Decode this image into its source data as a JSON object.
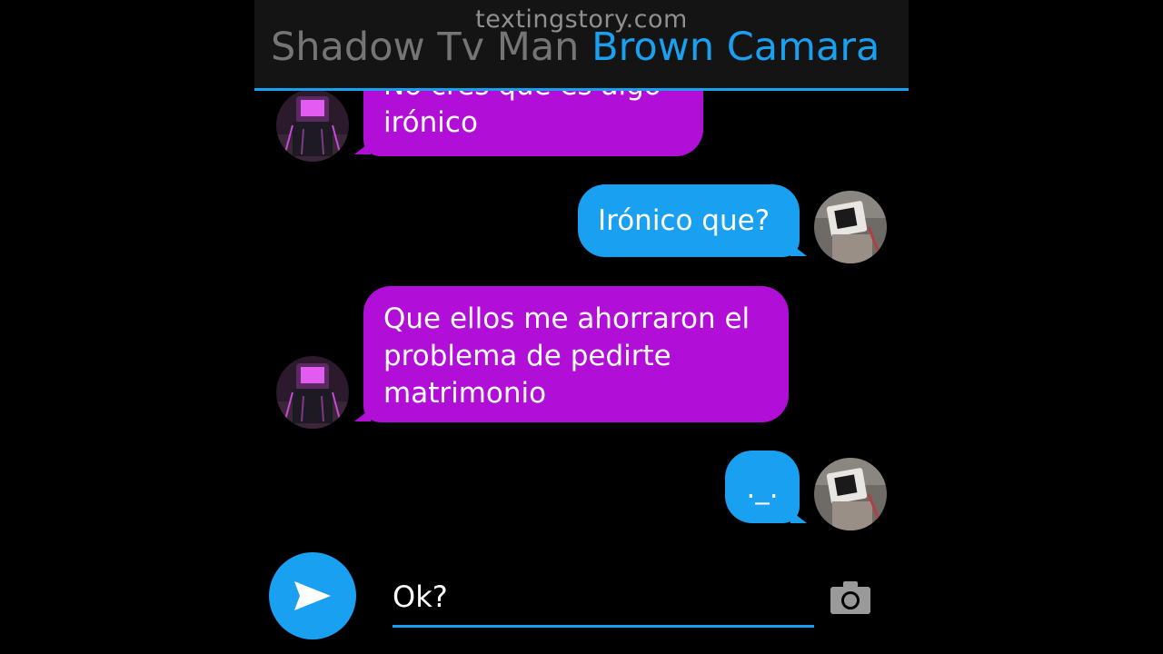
{
  "header": {
    "watermark": "textingstory.com",
    "left_contact": "Shadow Tv Man",
    "right_contact": "Brown Camara"
  },
  "messages": [
    {
      "side": "left",
      "line1": "No crés que es algo",
      "line2": "irónico"
    },
    {
      "side": "right",
      "text": "Irónico que?"
    },
    {
      "side": "left",
      "line1": "Que ellos me ahorraron el",
      "line2": "problema de pedirte",
      "line3": "matrimonio"
    },
    {
      "side": "right",
      "text": "._."
    }
  ],
  "composer": {
    "input_value": "Ok?",
    "send_icon": "send-icon",
    "camera_icon": "camera-icon"
  },
  "colors": {
    "accent": "#1aa0f0",
    "left_bubble": "#b10fd8",
    "header_bg": "#141414",
    "background": "#000000"
  }
}
